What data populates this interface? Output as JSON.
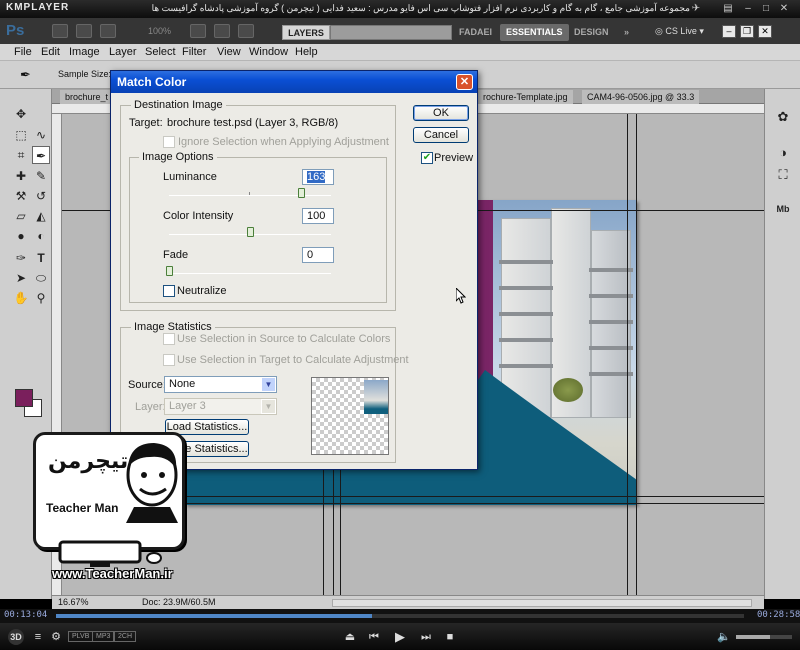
{
  "kmplayer": {
    "logo": "KMPLAYER",
    "title": "مجموعه آموزشی جامع ، گام به گام و کاربردی نرم افزار فتوشاپ سی اس فایو مدرس : سعید فدایی ( تیچرمن ) گروه آموزشی پادشاه گرافیست ها",
    "time_current": "00:13:04",
    "time_total": "00:28:58",
    "seek_progress": 0.46,
    "volume_level": 0.6,
    "badges": [
      "PLVB",
      "MP3",
      "2CH"
    ],
    "mode_3d": "3D"
  },
  "photoshop": {
    "logo": "Ps",
    "zoom_box": "100%",
    "layers_tab": "LAYERS",
    "workspaces": [
      "FADAEI",
      "ESSENTIALS",
      "DESIGN"
    ],
    "workspace_more": "»",
    "cs_live": "CS Live",
    "menu": [
      "File",
      "Edit",
      "Image",
      "Layer",
      "Select",
      "Filter",
      "View",
      "Window",
      "Help"
    ],
    "options_bar": {
      "sample_size_label": "Sample Size:"
    },
    "doc_tabs": [
      "brochure_t",
      "rochure-Template.jpg",
      "CAM4-96-0506.jpg @ 33.3"
    ],
    "status": {
      "zoom": "16.67%",
      "doc": "Doc: 23.9M/60.5M"
    }
  },
  "dialog": {
    "title": "Match Color",
    "close": "✕",
    "destination": {
      "group_label": "Destination Image",
      "target_label": "Target:",
      "target_value": "brochure test.psd (Layer 3, RGB/8)",
      "ignore_selection": "Ignore Selection when Applying Adjustment"
    },
    "image_options": {
      "group_label": "Image Options",
      "luminance_label": "Luminance",
      "luminance_value": "163",
      "luminance_level": 0.815,
      "color_intensity_label": "Color Intensity",
      "color_intensity_value": "100",
      "color_intensity_level": 0.5,
      "fade_label": "Fade",
      "fade_value": "0",
      "fade_level": 0,
      "neutralize": "Neutralize"
    },
    "image_statistics": {
      "group_label": "Image Statistics",
      "use_selection_source": "Use Selection in Source to Calculate Colors",
      "use_selection_target": "Use Selection in Target to Calculate Adjustment",
      "source_label": "Source:",
      "source_value": "None",
      "layer_label": "Layer:",
      "layer_value": "Layer 3",
      "load_statistics": "Load Statistics...",
      "save_statistics": "Save Statistics..."
    },
    "buttons": {
      "ok": "OK",
      "cancel": "Cancel",
      "preview": "Preview",
      "preview_checked": true
    }
  },
  "overlay": {
    "brand_fa": "تیچرمن",
    "brand_en": "Teacher Man",
    "url": "www.TeacherMan.ir"
  },
  "colors": {
    "foreground": "#7a1f5c",
    "background": "#ffffff",
    "teal": "#0e5d7b",
    "purple": "#7a2566",
    "xp_titlebar": "#0a4fd4"
  }
}
